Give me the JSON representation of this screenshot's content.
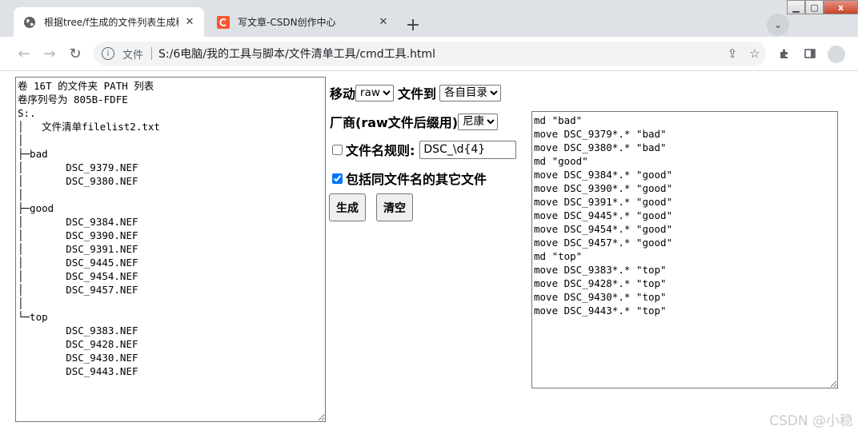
{
  "browser": {
    "tabs": [
      {
        "title": "根据tree/f生成的文件列表生成移",
        "active": true
      },
      {
        "title": "写文章-CSDN创作中心",
        "active": false,
        "favicon_color": "#fc5531"
      }
    ],
    "new_tab": "+",
    "tab_search": "⌄",
    "window_buttons": {
      "minimize": "▁",
      "maximize": "▢",
      "close": "x"
    },
    "address": {
      "scheme_label": "文件",
      "url": "S:/6电脑/我的工具与脚本/文件清单工具/cmd工具.html"
    }
  },
  "page": {
    "source_text": "卷 16T 的文件夹 PATH 列表\n卷序列号为 805B-FDFE\nS:.\n│   文件清单filelist2.txt\n│\n├─bad\n│       DSC_9379.NEF\n│       DSC_9380.NEF\n│\n├─good\n│       DSC_9384.NEF\n│       DSC_9390.NEF\n│       DSC_9391.NEF\n│       DSC_9445.NEF\n│       DSC_9454.NEF\n│       DSC_9457.NEF\n│\n└─top\n        DSC_9383.NEF\n        DSC_9428.NEF\n        DSC_9430.NEF\n        DSC_9443.NEF",
    "move_label": "移动",
    "move_type_value": "raw",
    "files_to_label": "文件到",
    "dest_value": "各自目录",
    "vendor_label": "厂商(raw文件后缀用)",
    "vendor_value": "尼康",
    "filename_rule_label": "文件名规则:",
    "filename_rule_checked": false,
    "filename_rule_value": "DSC_\\d{4}",
    "include_same_name_label": "包括同文件名的其它文件",
    "include_same_name_checked": true,
    "generate_button": "生成",
    "clear_button": "清空",
    "output_text": "md \"bad\"\nmove DSC_9379*.* \"bad\"\nmove DSC_9380*.* \"bad\"\nmd \"good\"\nmove DSC_9384*.* \"good\"\nmove DSC_9390*.* \"good\"\nmove DSC_9391*.* \"good\"\nmove DSC_9445*.* \"good\"\nmove DSC_9454*.* \"good\"\nmove DSC_9457*.* \"good\"\nmd \"top\"\nmove DSC_9383*.* \"top\"\nmove DSC_9428*.* \"top\"\nmove DSC_9430*.* \"top\"\nmove DSC_9443*.* \"top\""
  },
  "watermark": "CSDN @小稳"
}
